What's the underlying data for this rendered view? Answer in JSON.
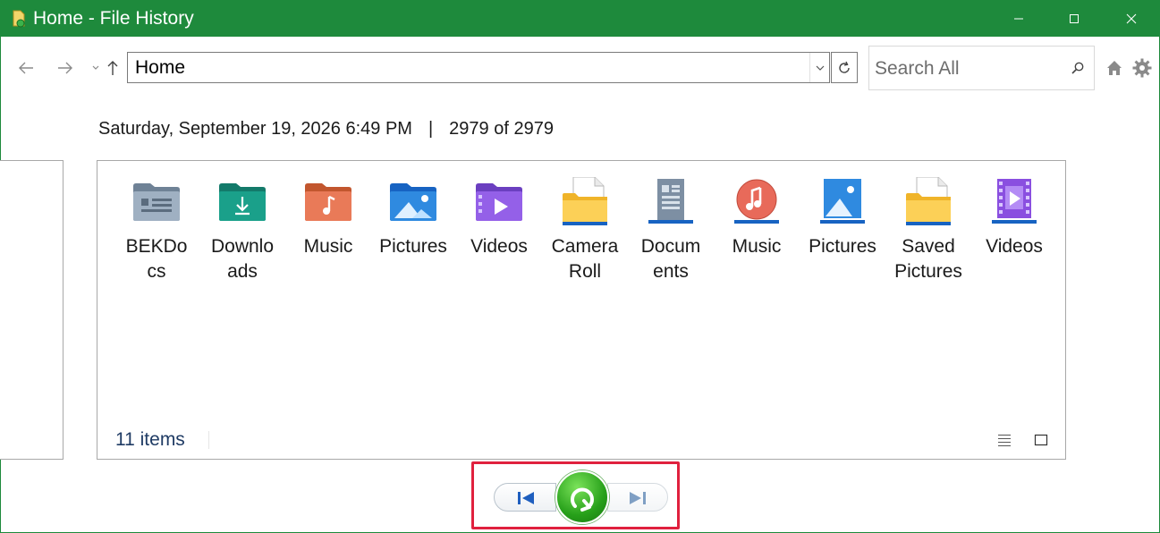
{
  "window": {
    "title": "Home - File History",
    "accent": "#1e8a3c"
  },
  "nav": {
    "address": "Home",
    "search_placeholder": "Search All"
  },
  "info": {
    "date": "Saturday, September 19, 2026 6:49 PM",
    "separator": "|",
    "position": "2979 of 2979"
  },
  "items": [
    {
      "label": "BEKDocs",
      "icon": "folder-docs-icon"
    },
    {
      "label": "Downloads",
      "icon": "folder-downloads-icon"
    },
    {
      "label": "Music",
      "icon": "folder-music-icon"
    },
    {
      "label": "Pictures",
      "icon": "folder-pictures-icon"
    },
    {
      "label": "Videos",
      "icon": "folder-videos-icon"
    },
    {
      "label": "Camera Roll",
      "icon": "folder-yellow-icon"
    },
    {
      "label": "Documents",
      "icon": "documents-library-icon"
    },
    {
      "label": "Music",
      "icon": "music-library-icon"
    },
    {
      "label": "Pictures",
      "icon": "pictures-library-icon"
    },
    {
      "label": "Saved Pictures",
      "icon": "folder-yellow-icon"
    },
    {
      "label": "Videos",
      "icon": "videos-library-icon"
    }
  ],
  "status": {
    "count": "11 items"
  },
  "controls": {
    "highlight_color": "#e0213e"
  }
}
